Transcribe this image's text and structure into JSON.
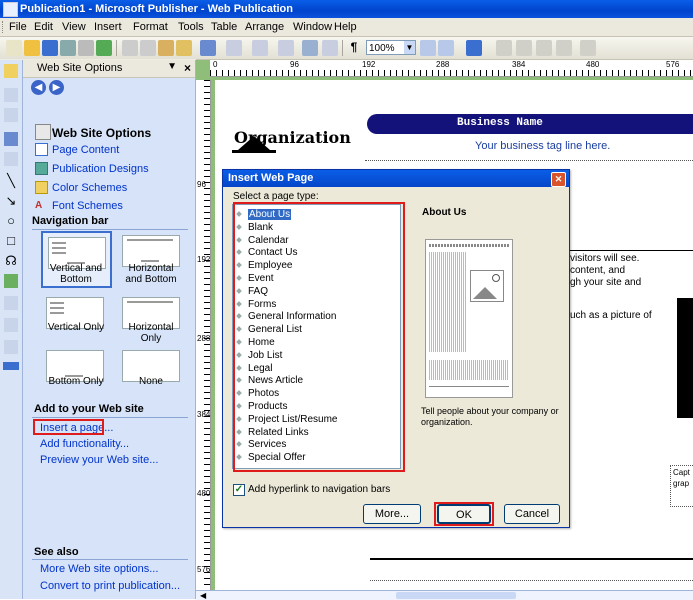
{
  "window": {
    "title": "Publication1 - Microsoft Publisher - Web Publication"
  },
  "menu": [
    "File",
    "Edit",
    "View",
    "Insert",
    "Format",
    "Tools",
    "Table",
    "Arrange",
    "Window",
    "Help"
  ],
  "toolbar": {
    "zoom": "100%"
  },
  "ruler": {
    "h": [
      "0",
      "96",
      "192",
      "288",
      "384",
      "480",
      "576"
    ],
    "v": [
      "96",
      "192",
      "288",
      "384",
      "480",
      "576"
    ]
  },
  "taskpane": {
    "title": "Web Site Options",
    "heading": "Web Site Options",
    "links": [
      "Page Content",
      "Publication Designs",
      "Color Schemes",
      "Font Schemes"
    ],
    "nav_heading": "Navigation bar",
    "nav_options": [
      "Vertical and Bottom",
      "Horizontal and Bottom",
      "Vertical Only",
      "Horizontal Only",
      "Bottom Only",
      "None"
    ],
    "add_heading": "Add to your Web site",
    "add_links": [
      "Insert a page...",
      "Add functionality...",
      "Preview your Web site..."
    ],
    "see_also_heading": "See also",
    "see_also_links": [
      "More Web site options...",
      "Convert to print publication..."
    ]
  },
  "document": {
    "organization": "Organization",
    "business_name": "Business Name",
    "tagline": "Your business tag line here.",
    "body_lines": [
      "visitors will see.",
      "content, and",
      "gh your site and",
      "uch as a picture of"
    ],
    "caption": [
      "Capt",
      "grap"
    ]
  },
  "dialog": {
    "title": "Insert Web Page",
    "select_label": "Select a page type:",
    "page_types": [
      "About Us",
      "Blank",
      "Calendar",
      "Contact Us",
      "Employee",
      "Event",
      "FAQ",
      "Forms",
      "General Information",
      "General List",
      "Home",
      "Job List",
      "Legal",
      "News Article",
      "Photos",
      "Products",
      "Project List/Resume",
      "Related Links",
      "Services",
      "Special Offer"
    ],
    "selected": "About Us",
    "preview_title": "About Us",
    "preview_desc": "Tell people about your company or organization.",
    "checkbox_label": "Add hyperlink to navigation bars",
    "checkbox_checked": true,
    "buttons": {
      "more": "More...",
      "ok": "OK",
      "cancel": "Cancel"
    }
  }
}
